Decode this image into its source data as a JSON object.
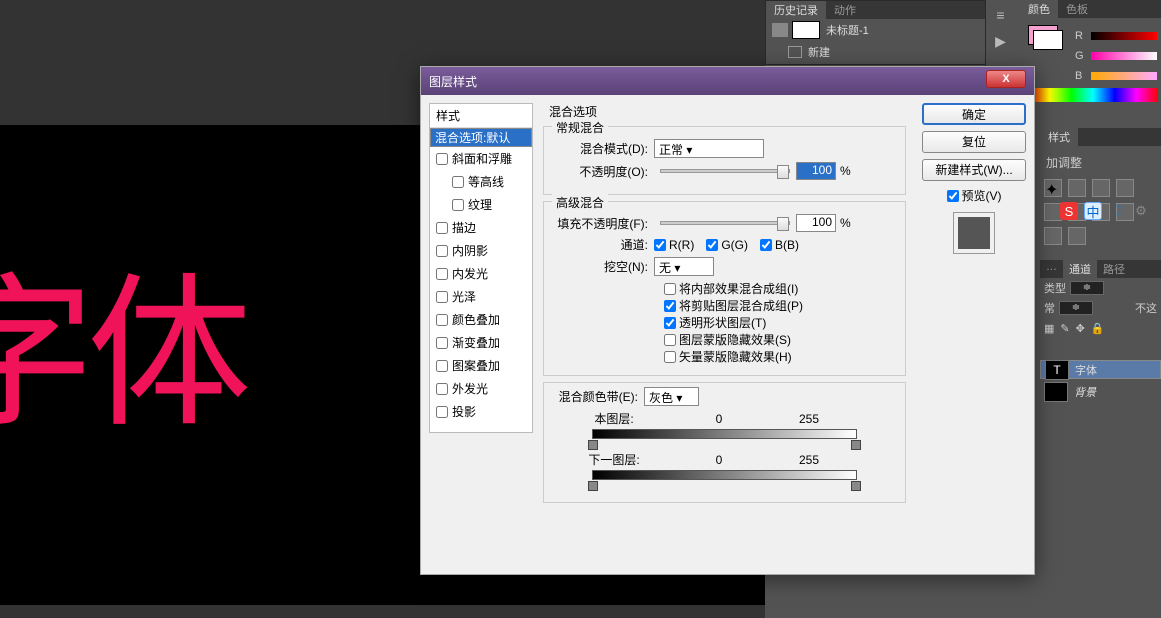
{
  "canvas": {
    "big_text": "字体"
  },
  "history": {
    "tab_history": "历史记录",
    "tab_actions": "动作",
    "doc_name": "未标题-1",
    "item_new": "新建"
  },
  "color_panel": {
    "tab_color": "颜色",
    "tab_swatches": "色板",
    "r": "R",
    "g": "G",
    "b": "B"
  },
  "adjust": {
    "label": "加调整"
  },
  "extra_tabs": {
    "t1": "样式"
  },
  "channels": {
    "tab_ch": "通道",
    "tab_path": "路径",
    "kind": "类型",
    "normal": "常",
    "notpass": "不这"
  },
  "layers": {
    "layer1": "字体",
    "layer2": "背景"
  },
  "dialog": {
    "title": "图层样式",
    "styles_hdr": "样式",
    "blend_default": "混合选项:默认",
    "bevel": "斜面和浮雕",
    "contour": "等高线",
    "texture": "纹理",
    "stroke": "描边",
    "inner_shadow": "内阴影",
    "inner_glow": "内发光",
    "satin": "光泽",
    "color_overlay": "颜色叠加",
    "grad_overlay": "渐变叠加",
    "pattern_overlay": "图案叠加",
    "outer_glow": "外发光",
    "drop_shadow": "投影",
    "sec_blend": "混合选项",
    "grp_general": "常规混合",
    "blend_mode_lbl": "混合模式(D):",
    "blend_mode_val": "正常",
    "opacity_lbl": "不透明度(O):",
    "opacity_val": "100",
    "pct": "%",
    "grp_advanced": "高级混合",
    "fill_opacity_lbl": "填充不透明度(F):",
    "fill_opacity_val": "100",
    "channels_lbl": "通道:",
    "ch_r": "R(R)",
    "ch_g": "G(G)",
    "ch_b": "B(B)",
    "knockout_lbl": "挖空(N):",
    "knockout_val": "无",
    "opt1": "将内部效果混合成组(I)",
    "opt2": "将剪贴图层混合成组(P)",
    "opt3": "透明形状图层(T)",
    "opt4": "图层蒙版隐藏效果(S)",
    "opt5": "矢量蒙版隐藏效果(H)",
    "blend_if_lbl": "混合颜色带(E):",
    "blend_if_val": "灰色",
    "this_layer": "本图层:",
    "under_layer": "下一图层:",
    "v0": "0",
    "v255": "255",
    "btn_ok": "确定",
    "btn_cancel": "复位",
    "btn_newstyle": "新建样式(W)...",
    "preview": "预览(V)"
  },
  "status": {
    "s": "S",
    "cn": "中"
  }
}
